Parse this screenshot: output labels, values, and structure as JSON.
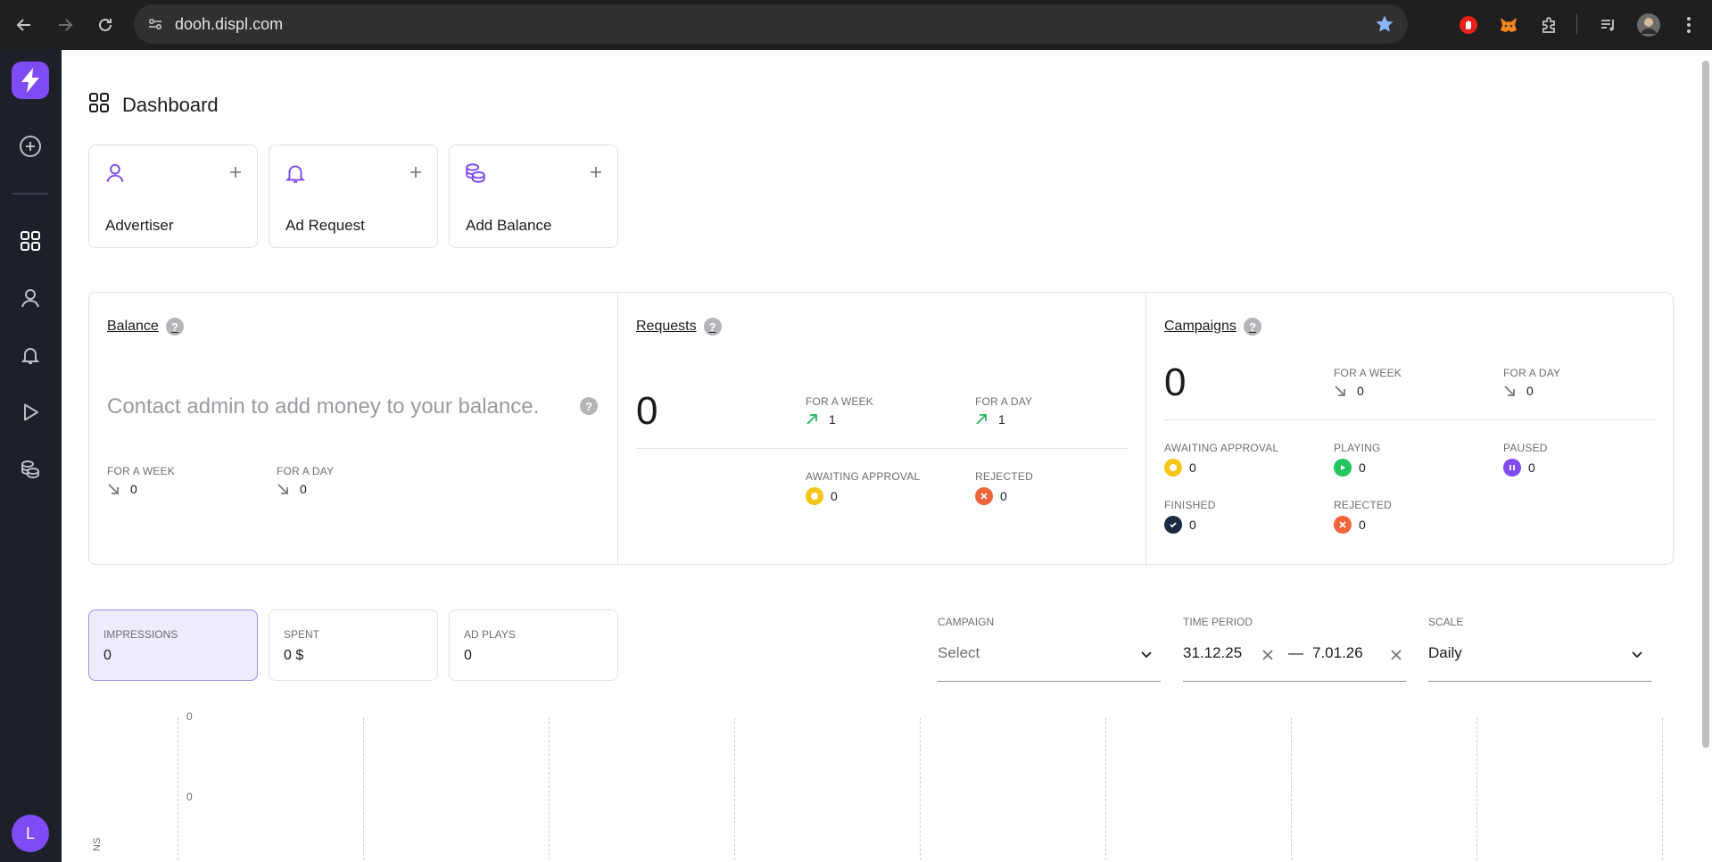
{
  "browser": {
    "url": "dooh.displ.com"
  },
  "sidebar": {
    "avatar_letter": "L"
  },
  "page": {
    "title": "Dashboard"
  },
  "quick_actions": [
    {
      "label": "Advertiser",
      "icon": "user-icon"
    },
    {
      "label": "Ad Request",
      "icon": "bell-icon"
    },
    {
      "label": "Add Balance",
      "icon": "coins-icon"
    }
  ],
  "balance": {
    "title": "Balance",
    "message": "Contact admin to add money to your balance.",
    "week_label": "FOR A WEEK",
    "week_value": "0",
    "day_label": "FOR A DAY",
    "day_value": "0"
  },
  "requests": {
    "title": "Requests",
    "total": "0",
    "week_label": "FOR A WEEK",
    "week_value": "1",
    "day_label": "FOR A DAY",
    "day_value": "1",
    "awaiting_label": "AWAITING APPROVAL",
    "awaiting_value": "0",
    "rejected_label": "REJECTED",
    "rejected_value": "0"
  },
  "campaigns": {
    "title": "Campaigns",
    "total": "0",
    "week_label": "FOR A WEEK",
    "week_value": "0",
    "day_label": "FOR A DAY",
    "day_value": "0",
    "awaiting_label": "AWAITING APPROVAL",
    "awaiting_value": "0",
    "playing_label": "PLAYING",
    "playing_value": "0",
    "paused_label": "PAUSED",
    "paused_value": "0",
    "finished_label": "FINISHED",
    "finished_value": "0",
    "rejected_label": "REJECTED",
    "rejected_value": "0"
  },
  "metrics": [
    {
      "label": "IMPRESSIONS",
      "value": "0"
    },
    {
      "label": "SPENT",
      "value": "0 $"
    },
    {
      "label": "AD PLAYS",
      "value": "0"
    }
  ],
  "filters": {
    "campaign_label": "CAMPAIGN",
    "campaign_placeholder": "Select",
    "period_label": "TIME PERIOD",
    "period_start": "31.12.25",
    "period_sep": "—",
    "period_end": "7.01.26",
    "scale_label": "SCALE",
    "scale_value": "Daily"
  },
  "chart": {
    "y_ticks": [
      "0",
      "0"
    ],
    "y_label": "NS"
  },
  "colors": {
    "accent": "#7f4bf5",
    "sidebar_bg": "#1d2029",
    "trend_up": "#1fb25a",
    "awaiting": "#f5c518",
    "playing": "#22c55e",
    "paused": "#7f4bf5",
    "finished": "#1d2a44",
    "rejected": "#f0643c"
  }
}
